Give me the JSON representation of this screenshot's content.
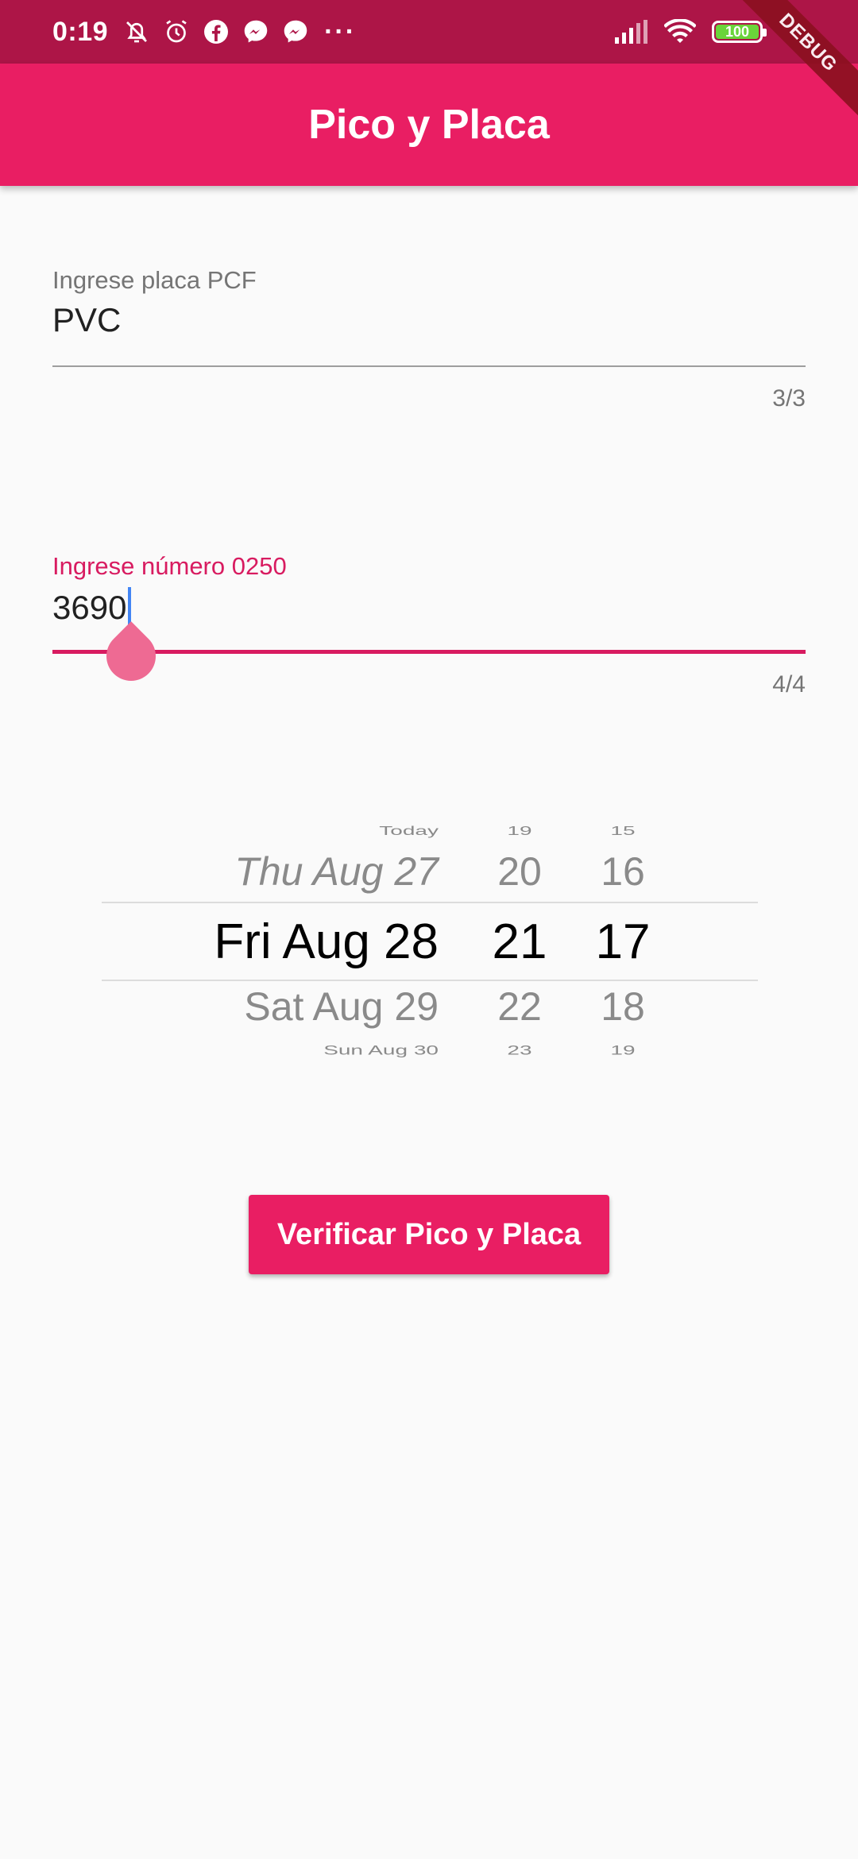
{
  "status_bar": {
    "time": "0:19",
    "left_icons": [
      "muted-bell-icon",
      "alarm-icon",
      "facebook-icon",
      "messenger-icon",
      "messenger-icon"
    ],
    "more": "···",
    "battery_level": "100",
    "battery_percent": 100
  },
  "debug_banner": "DEBUG",
  "app_bar": {
    "title": "Pico y Placa"
  },
  "plate_field": {
    "label": "Ingrese placa PCF",
    "value": "PVC",
    "counter": "3/3"
  },
  "number_field": {
    "label": "Ingrese número 0250",
    "value": "3690",
    "counter": "4/4"
  },
  "date_picker": {
    "dates": [
      "Today",
      "Thu Aug 27",
      "Fri Aug 28",
      "Sat Aug 29",
      "Sun Aug 30"
    ],
    "hours": [
      "19",
      "20",
      "21",
      "22",
      "23"
    ],
    "minutes": [
      "15",
      "16",
      "17",
      "18",
      "19"
    ],
    "selected": {
      "date": "Fri Aug 28",
      "hour": "21",
      "minute": "17"
    }
  },
  "verify_button": {
    "label": "Verificar Pico y Placa"
  },
  "colors": {
    "primary": "#e91e63",
    "status_bar": "#ad1547",
    "accent_label": "#d81b60",
    "background": "#fafafa"
  }
}
